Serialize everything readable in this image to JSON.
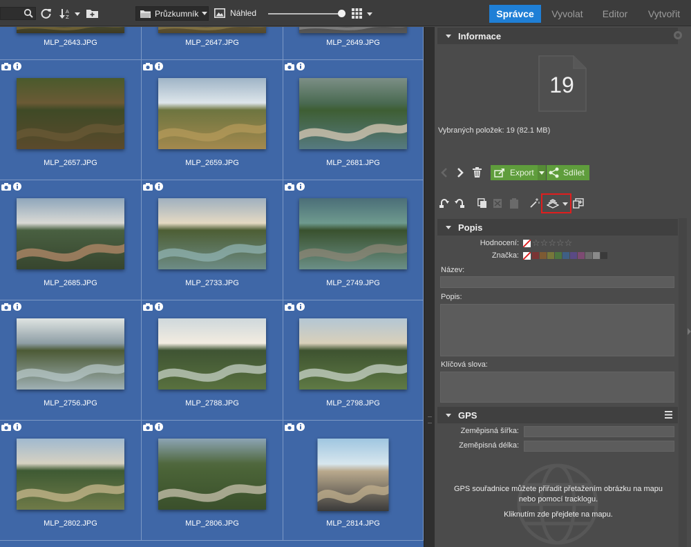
{
  "toolbar": {
    "source_label": "Průzkumník",
    "view_label": "Náhled",
    "zoom_level": 0.96,
    "icons": [
      "search-icon",
      "refresh-icon",
      "sort-icon",
      "new-folder-icon",
      "folder-icon",
      "preview-icon",
      "grid-icon"
    ]
  },
  "modes": [
    {
      "label": "Správce",
      "active": true
    },
    {
      "label": "Vyvolat",
      "active": false
    },
    {
      "label": "Editor",
      "active": false
    },
    {
      "label": "Vytvořit",
      "active": false
    }
  ],
  "thumbnails": [
    {
      "name": "MLP_2643.JPG",
      "scene": "balloon"
    },
    {
      "name": "MLP_2647.JPG",
      "scene": "car"
    },
    {
      "name": "MLP_2649.JPG",
      "scene": "balloon-top"
    },
    {
      "name": "MLP_2657.JPG",
      "scene": "forest"
    },
    {
      "name": "MLP_2659.JPG",
      "scene": "hills"
    },
    {
      "name": "MLP_2681.JPG",
      "scene": "castle"
    },
    {
      "name": "MLP_2685.JPG",
      "scene": "castle-sky"
    },
    {
      "name": "MLP_2733.JPG",
      "scene": "river"
    },
    {
      "name": "MLP_2749.JPG",
      "scene": "ruin"
    },
    {
      "name": "MLP_2756.JPG",
      "scene": "ruin-sun"
    },
    {
      "name": "MLP_2788.JPG",
      "scene": "river-sun"
    },
    {
      "name": "MLP_2798.JPG",
      "scene": "river-wide"
    },
    {
      "name": "MLP_2802.JPG",
      "scene": "river-fields"
    },
    {
      "name": "MLP_2806.JPG",
      "scene": "river-bend"
    },
    {
      "name": "MLP_2814.JPG",
      "scene": "balloon-inside"
    }
  ],
  "info": {
    "title": "Informace",
    "count": "19",
    "selected_text": "Vybraných položek: 19 (82.1 MB)",
    "export_label": "Export",
    "share_label": "Sdílet"
  },
  "description": {
    "title": "Popis",
    "rating_label": "Hodnocení:",
    "mark_label": "Značka:",
    "name_label": "Název:",
    "desc_label": "Popis:",
    "keywords_label": "Klíčová slova:",
    "mark_colors": [
      "#7a3434",
      "#7d5a33",
      "#77773a",
      "#4d7540",
      "#3f5f84",
      "#5a4a85",
      "#7d4a72",
      "#6a6a6a",
      "#8a8a8a",
      "#3a3a3a"
    ]
  },
  "gps": {
    "title": "GPS",
    "lat_label": "Zeměpisná šířka:",
    "lon_label": "Zeměpisná délka:",
    "hint1": "GPS souřadnice můžete přiřadit přetažením obrázku na mapu",
    "hint2": "nebo pomocí tracklogu.",
    "hint3": "Kliknutím zde přejdete na mapu."
  }
}
